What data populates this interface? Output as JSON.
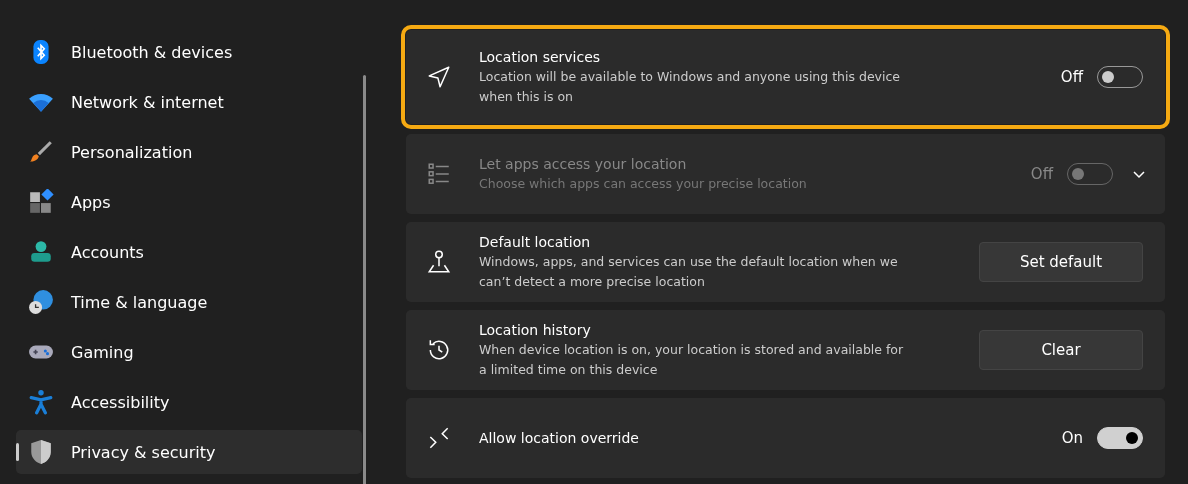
{
  "sidebar": {
    "items": [
      {
        "label": "Bluetooth & devices",
        "selected": false
      },
      {
        "label": "Network & internet",
        "selected": false
      },
      {
        "label": "Personalization",
        "selected": false
      },
      {
        "label": "Apps",
        "selected": false
      },
      {
        "label": "Accounts",
        "selected": false
      },
      {
        "label": "Time & language",
        "selected": false
      },
      {
        "label": "Gaming",
        "selected": false
      },
      {
        "label": "Accessibility",
        "selected": false
      },
      {
        "label": "Privacy & security",
        "selected": true
      }
    ]
  },
  "settings": [
    {
      "kind": "toggle",
      "title": "Location services",
      "description": "Location will be available to Windows and anyone using this device when this is on",
      "state_label": "Off",
      "on": false,
      "highlighted": true,
      "disabled": false,
      "expandable": false
    },
    {
      "kind": "toggle",
      "title": "Let apps access your location",
      "description": "Choose which apps can access your precise location",
      "state_label": "Off",
      "on": false,
      "highlighted": false,
      "disabled": true,
      "expandable": true
    },
    {
      "kind": "button",
      "title": "Default location",
      "description": "Windows, apps, and services can use the default location when we can’t detect a more precise location",
      "button": "Set default",
      "highlighted": false,
      "disabled": false
    },
    {
      "kind": "button",
      "title": "Location history",
      "description": "When device location is on, your location is stored and available for a limited time on this device",
      "button": "Clear",
      "highlighted": false,
      "disabled": false
    },
    {
      "kind": "toggle",
      "title": "Allow location override",
      "state_label": "On",
      "on": true,
      "highlighted": false,
      "disabled": false,
      "expandable": false
    }
  ]
}
